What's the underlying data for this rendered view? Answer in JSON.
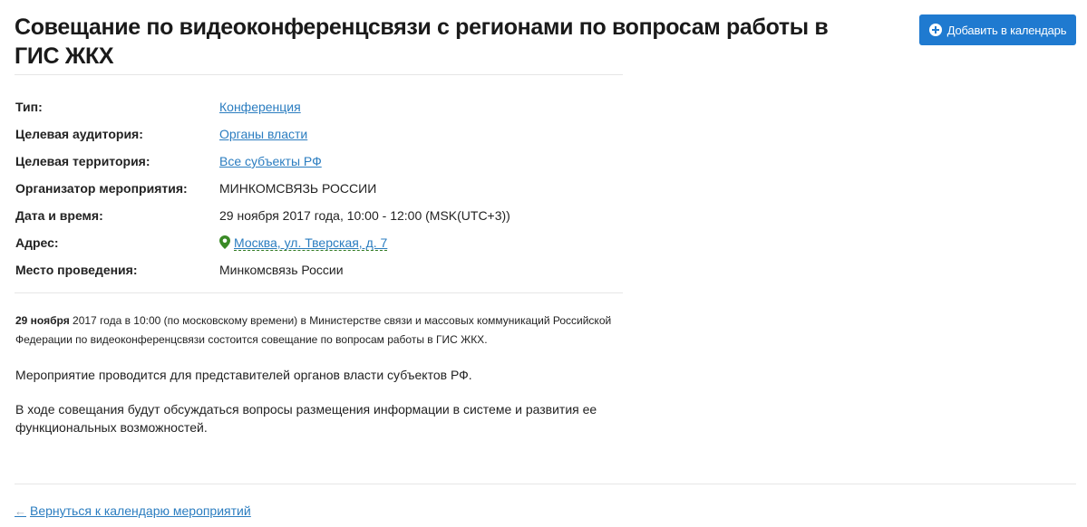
{
  "header": {
    "title": "Совещание по видеоконференцсвязи с регионами по вопросам работы в ГИС ЖКХ",
    "add_calendar_label": "Добавить в календарь",
    "add_calendar_icon": "plus-circle-icon"
  },
  "details": [
    {
      "label": "Тип:",
      "value": "Конференция",
      "link": true
    },
    {
      "label": "Целевая аудитория:",
      "value": "Органы власти",
      "link": true
    },
    {
      "label": "Целевая территория:",
      "value": "Все субъекты РФ",
      "link": true
    },
    {
      "label": "Организатор мероприятия:",
      "value": "МИНКОМСВЯЗЬ РОССИИ",
      "link": false
    },
    {
      "label": "Дата и время:",
      "value": "29 ноября 2017 года, 10:00 - 12:00 (MSK(UTC+3))",
      "link": false
    },
    {
      "label": "Адрес:",
      "value": "Москва, ул. Тверская, д. 7",
      "link": true,
      "icon": "map-pin-icon"
    },
    {
      "label": "Место проведения:",
      "value": "Минкомсвязь России",
      "link": false
    }
  ],
  "description": {
    "lead_bold": "29 ноября",
    "lead_rest": " 2017 года в 10:00 (по московскому времени) в Министерстве связи и массовых коммуникаций Российской Федерации по видеоконференцсвязи состоится совещание по вопросам работы в ГИС ЖКХ.",
    "p1": "Мероприятие проводится для представителей органов власти субъектов РФ.",
    "p2": "В ходе совещания будут обсуждаться вопросы размещения информации в системе и развития ее функциональных возможностей."
  },
  "footer": {
    "back_icon": "arrow-left-icon",
    "back_label": "Вернуться к календарю мероприятий"
  },
  "colors": {
    "accent": "#1f7ad0",
    "link": "#2b7dc0",
    "address_link": "#2f7a1f"
  }
}
